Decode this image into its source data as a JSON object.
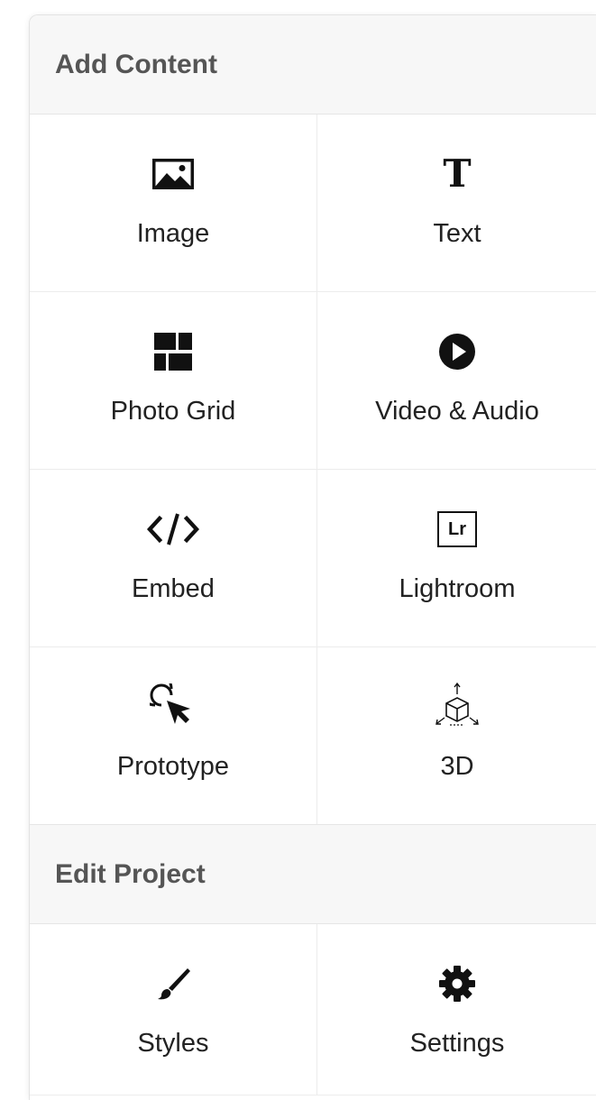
{
  "add_content": {
    "title": "Add Content",
    "items": [
      {
        "label": "Image",
        "icon": "image-icon"
      },
      {
        "label": "Text",
        "icon": "text-icon"
      },
      {
        "label": "Photo Grid",
        "icon": "photo-grid-icon"
      },
      {
        "label": "Video & Audio",
        "icon": "play-icon"
      },
      {
        "label": "Embed",
        "icon": "code-icon"
      },
      {
        "label": "Lightroom",
        "icon": "lightroom-icon"
      },
      {
        "label": "Prototype",
        "icon": "prototype-cursor-icon"
      },
      {
        "label": "3D",
        "icon": "3d-cube-icon"
      }
    ]
  },
  "edit_project": {
    "title": "Edit Project",
    "items": [
      {
        "label": "Styles",
        "icon": "brush-icon"
      },
      {
        "label": "Settings",
        "icon": "gear-icon"
      }
    ]
  },
  "icons": {
    "lightroom_badge": "Lr",
    "text_glyph": "T"
  },
  "colors": {
    "header_bg": "#f7f7f7",
    "header_text": "#555555",
    "label_text": "#222222",
    "divider": "#ececec"
  }
}
